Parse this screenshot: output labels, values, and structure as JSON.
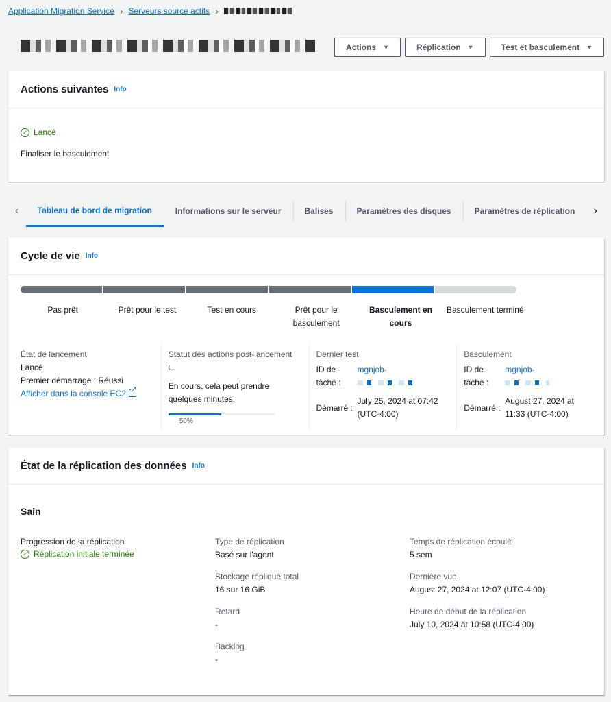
{
  "breadcrumb": {
    "items": [
      "Application Migration Service",
      "Serveurs source actifs"
    ]
  },
  "header": {
    "buttons": [
      {
        "label": "Actions"
      },
      {
        "label": "Réplication"
      },
      {
        "label": "Test et basculement"
      }
    ]
  },
  "next_actions": {
    "title": "Actions suivantes",
    "info": "Info",
    "status": "Lancé",
    "description": "Finaliser le basculement"
  },
  "tabs": [
    {
      "label": "Tableau de bord de migration",
      "active": true
    },
    {
      "label": "Informations sur le serveur"
    },
    {
      "label": "Balises"
    },
    {
      "label": "Paramètres des disques"
    },
    {
      "label": "Paramètres de réplication"
    }
  ],
  "lifecycle": {
    "title": "Cycle de vie",
    "info": "Info",
    "steps": [
      {
        "label": "Pas prêt",
        "state": "done"
      },
      {
        "label": "Prêt pour le test",
        "state": "done"
      },
      {
        "label": "Test en cours",
        "state": "done"
      },
      {
        "label": "Prêt pour le basculement",
        "state": "done"
      },
      {
        "label": "Basculement en cours",
        "state": "current"
      },
      {
        "label": "Basculement terminé",
        "state": "pending"
      }
    ],
    "launch": {
      "label": "État de lancement",
      "value": "Lancé",
      "first_boot": "Premier démarrage : Réussi",
      "console_link": "Afficher dans la console EC2"
    },
    "post_launch": {
      "label": "Statut des actions post-lancement",
      "text": "En cours, cela peut prendre quelques minutes.",
      "progress": 0.5,
      "progress_label": "50%"
    },
    "last_test": {
      "label": "Dernier test",
      "job_label": "ID de tâche :",
      "job_id": "mgnjob-",
      "started_label": "Démarré :",
      "started": "July 25, 2024 at 07:42 (UTC-4:00)"
    },
    "cutover": {
      "label": "Basculement",
      "job_label": "ID de tâche :",
      "job_id": "mgnjob-",
      "started_label": "Démarré :",
      "started": "August 27, 2024 at 11:33 (UTC-4:00)"
    }
  },
  "replication": {
    "title": "État de la réplication des données",
    "info": "Info",
    "health": "Sain",
    "progress_label": "Progression de la réplication",
    "progress_value": "Réplication initiale terminée",
    "type_label": "Type de réplication",
    "type_value": "Basé sur l'agent",
    "storage_label": "Stockage répliqué total",
    "storage_value": "16 sur 16 GiB",
    "lag_label": "Retard",
    "lag_value": "-",
    "backlog_label": "Backlog",
    "backlog_value": "-",
    "elapsed_label": "Temps de réplication écoulé",
    "elapsed_value": "5 sem",
    "last_seen_label": "Dernière vue",
    "last_seen_value": "August 27, 2024 at 12:07 (UTC-4:00)",
    "start_label": "Heure de début de la réplication",
    "start_value": "July 10, 2024 at 10:58 (UTC-4:00)"
  },
  "colors": {
    "accent": "#0972d3",
    "success": "#1d8102",
    "done_segment": "#687078",
    "pending_segment": "#d5dbdb"
  }
}
